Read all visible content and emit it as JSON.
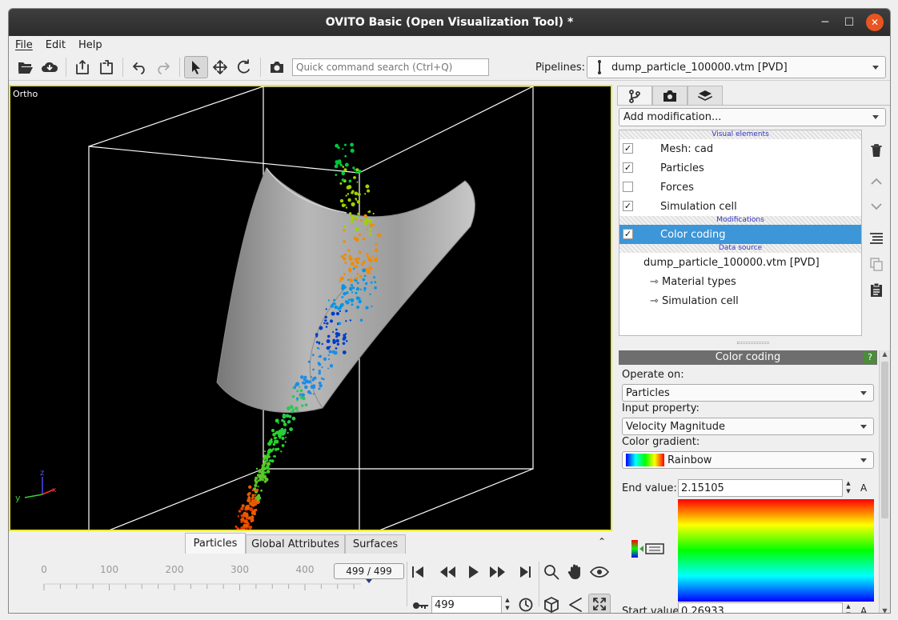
{
  "window": {
    "title": "OVITO Basic (Open Visualization Tool) *"
  },
  "menu": [
    "File",
    "Edit",
    "Help"
  ],
  "toolbar": {
    "search_placeholder": "Quick command search (Ctrl+Q)",
    "pipelines_label": "Pipelines:",
    "pipeline_selected": "dump_particle_100000.vtm [PVD]"
  },
  "viewport": {
    "label": "Ortho",
    "axes": {
      "z": "z",
      "y": "y",
      "x": "x"
    }
  },
  "bottom_tabs": [
    "Particles",
    "Global Attributes",
    "Surfaces"
  ],
  "animation": {
    "ticks": [
      "0",
      "100",
      "200",
      "300",
      "400"
    ],
    "frame_display": "499 / 499",
    "current_frame": "499",
    "progress": 1.0
  },
  "panel": {
    "add_modification": "Add modification...",
    "sections": {
      "visual": "Visual elements",
      "modifications": "Modifications",
      "data_source": "Data source"
    },
    "visual_elements": [
      {
        "label": "Mesh: cad",
        "checked": true
      },
      {
        "label": "Particles",
        "checked": true
      },
      {
        "label": "Forces",
        "checked": false
      },
      {
        "label": "Simulation cell",
        "checked": true
      }
    ],
    "modifications": [
      {
        "label": "Color coding",
        "checked": true,
        "selected": true
      }
    ],
    "data_source": {
      "name": "dump_particle_100000.vtm [PVD]",
      "subitems": [
        "⇾ Material types",
        "⇾ Simulation cell"
      ]
    }
  },
  "color_coding": {
    "title": "Color coding",
    "help": "?",
    "operate_on_label": "Operate on:",
    "operate_on": "Particles",
    "input_property_label": "Input property:",
    "input_property": "Velocity Magnitude",
    "gradient_label": "Color gradient:",
    "gradient": "Rainbow",
    "end_value_label": "End value:",
    "end_value": "2.15105",
    "start_value_label": "Start value:",
    "start_value": "0.26933",
    "auto": "A"
  }
}
